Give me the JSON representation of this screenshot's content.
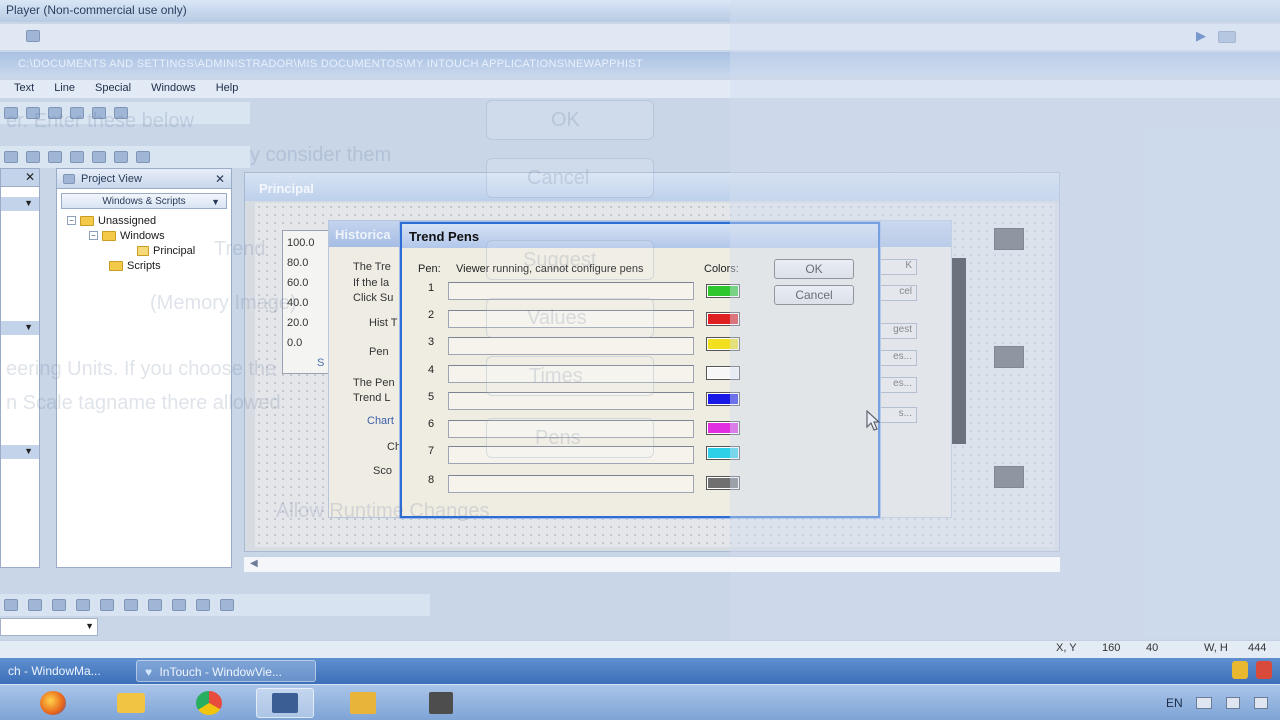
{
  "window": {
    "title": "Player (Non-commercial use only)",
    "path": "C:\\DOCUMENTS AND SETTINGS\\ADMINISTRADOR\\MIS DOCUMENTOS\\MY INTOUCH APPLICATIONS\\NEWAPPHIST"
  },
  "menu": [
    "Text",
    "Line",
    "Special",
    "Windows",
    "Help"
  ],
  "project_view": {
    "title": "Project View",
    "dropdown": "Windows & Scripts",
    "tree": {
      "root": "Unassigned",
      "windows": "Windows",
      "principal": "Principal",
      "scripts": "Scripts"
    }
  },
  "principal_window": {
    "title": "Principal",
    "axis_ticks": [
      "100.0",
      "80.0",
      "60.0",
      "40.0",
      "20.0",
      "0.0"
    ],
    "axis_stub": "S"
  },
  "historical_dialog": {
    "title": "Historica",
    "labels": [
      "The Tre",
      "If the la",
      "Click Su",
      "Hist T",
      "Pen",
      "The Pen",
      "Trend L",
      "Chart",
      "Ch",
      "Sco"
    ],
    "side_buttons": [
      "K",
      "cel",
      "gest",
      "es...",
      "es...",
      "s..."
    ]
  },
  "trend_pens": {
    "title": "Trend Pens",
    "pens_header": "Pen:",
    "status_text": "Viewer running, cannot configure pens",
    "colors_header": "Colors:",
    "ok_label": "OK",
    "cancel_label": "Cancel",
    "pens": [
      {
        "num": "1",
        "color": "#2ec82e"
      },
      {
        "num": "2",
        "color": "#e02020"
      },
      {
        "num": "3",
        "color": "#f0e020"
      },
      {
        "num": "4",
        "color": "#f7f7f7"
      },
      {
        "num": "5",
        "color": "#1a1ae6"
      },
      {
        "num": "6",
        "color": "#e02ee0"
      },
      {
        "num": "7",
        "color": "#2ed0e8"
      },
      {
        "num": "8",
        "color": "#707070"
      }
    ]
  },
  "status_bar": {
    "xy_label": "X, Y",
    "x": "160",
    "y": "40",
    "wh_label": "W, H",
    "wh": "444"
  },
  "taskbar": {
    "tasks": [
      "ch - WindowMa...",
      "InTouch - WindowVie..."
    ],
    "language": "EN"
  },
  "ghost": {
    "lines": [
      "er. Enter these below",
      "y consider them",
      "Trend",
      "(Memory Image)",
      "eering Units. If you choose the",
      "n Scale tagname there allowed",
      "Allow Runtime Changes"
    ],
    "buttons": [
      "OK",
      "Cancel",
      "Suggest",
      "Values",
      "Times",
      "Pens"
    ]
  }
}
